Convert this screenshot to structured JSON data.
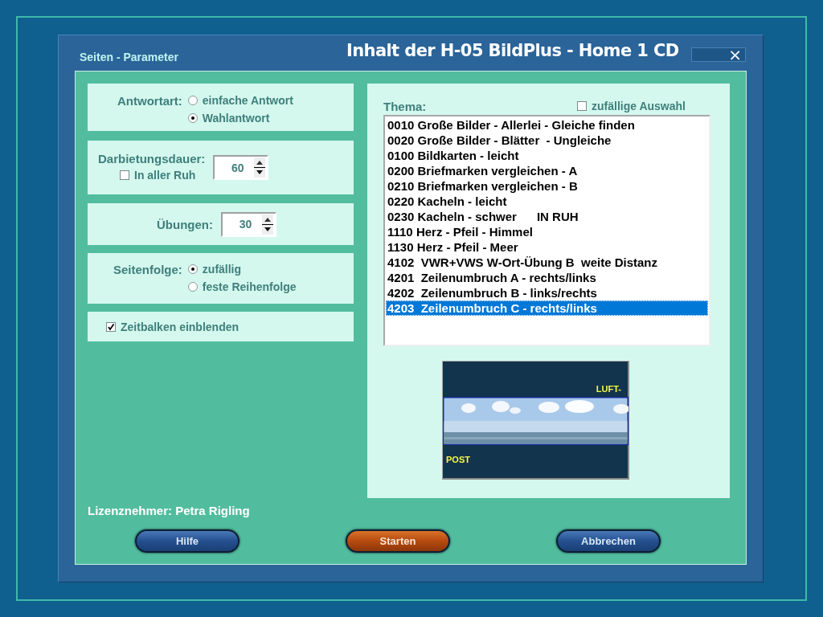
{
  "window": {
    "subtitle": "Seiten - Parameter",
    "title": "Inhalt der H-05 BildPlus - Home 1 CD",
    "close": "×"
  },
  "answer_type": {
    "label": "Antwortart:",
    "options": [
      {
        "label": "einfache Antwort",
        "selected": false
      },
      {
        "label": "Wahlantwort",
        "selected": true
      }
    ]
  },
  "duration": {
    "label": "Darbietungsdauer:",
    "value": "60",
    "calm": {
      "label": "In aller Ruh",
      "checked": false
    }
  },
  "exercises": {
    "label": "Übungen:",
    "value": "30"
  },
  "page_order": {
    "label": "Seitenfolge:",
    "options": [
      {
        "label": "zufällig",
        "selected": true
      },
      {
        "label": "feste Reihenfolge",
        "selected": false
      }
    ]
  },
  "time_bar": {
    "label": "Zeitbalken einblenden",
    "checked": true
  },
  "theme": {
    "label": "Thema:",
    "random": {
      "label": "zufällige Auswahl",
      "checked": false
    },
    "items": [
      {
        "text": "0010 Große Bilder - Allerlei - Gleiche finden",
        "selected": false
      },
      {
        "text": "0020 Große Bilder - Blätter  - Ungleiche",
        "selected": false
      },
      {
        "text": "0100 Bildkarten - leicht",
        "selected": false
      },
      {
        "text": "0200 Briefmarken vergleichen - A",
        "selected": false
      },
      {
        "text": "0210 Briefmarken vergleichen - B",
        "selected": false
      },
      {
        "text": "0220 Kacheln - leicht",
        "selected": false
      },
      {
        "text": "0230 Kacheln - schwer      IN RUH",
        "selected": false
      },
      {
        "text": "1110 Herz - Pfeil - Himmel",
        "selected": false
      },
      {
        "text": "1130 Herz - Pfeil - Meer",
        "selected": false
      },
      {
        "text": "4102  VWR+VWS W-Ort-Übung B  weite Distanz",
        "selected": false
      },
      {
        "text": "4201  Zeilenumbruch A - rechts/links",
        "selected": false
      },
      {
        "text": "4202  Zeilenumbruch B - links/rechts",
        "selected": false
      },
      {
        "text": "4203  Zeilenumbruch C - rechts/links",
        "selected": true
      }
    ]
  },
  "preview": {
    "kind": "picture",
    "top_label": "LUFT-",
    "bottom_label": "POST"
  },
  "licensee": "Lizenznehmer: Petra Rigling",
  "buttons": [
    {
      "label": "Hilfe",
      "kind": "normal"
    },
    {
      "label": "Starten",
      "kind": "primary"
    },
    {
      "label": "Abbrechen",
      "kind": "normal"
    }
  ]
}
